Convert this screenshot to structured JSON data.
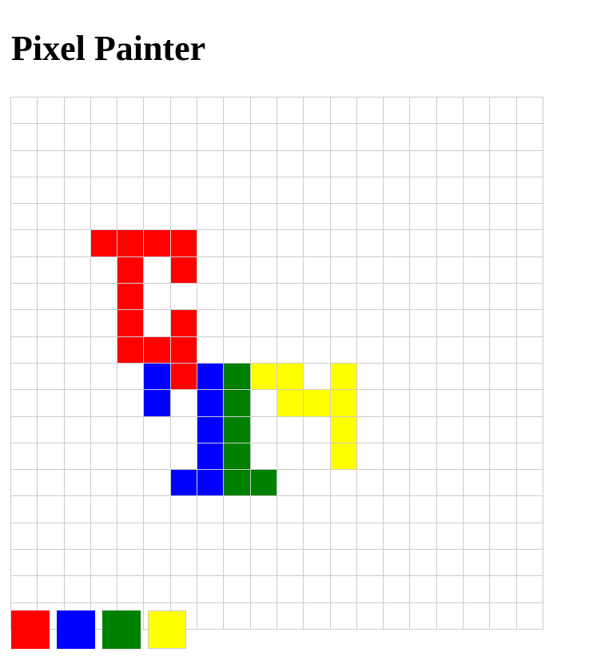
{
  "title": "Pixel Painter",
  "grid": {
    "cols": 20,
    "rows": 20,
    "empty_color": "#ffffff",
    "line_color": "#cccccc",
    "painted_cells": [
      {
        "row": 5,
        "col": 3,
        "color": "red"
      },
      {
        "row": 5,
        "col": 4,
        "color": "red"
      },
      {
        "row": 5,
        "col": 5,
        "color": "red"
      },
      {
        "row": 5,
        "col": 6,
        "color": "red"
      },
      {
        "row": 6,
        "col": 4,
        "color": "red"
      },
      {
        "row": 6,
        "col": 6,
        "color": "red"
      },
      {
        "row": 7,
        "col": 4,
        "color": "red"
      },
      {
        "row": 8,
        "col": 4,
        "color": "red"
      },
      {
        "row": 8,
        "col": 6,
        "color": "red"
      },
      {
        "row": 9,
        "col": 4,
        "color": "red"
      },
      {
        "row": 9,
        "col": 5,
        "color": "red"
      },
      {
        "row": 9,
        "col": 6,
        "color": "red"
      },
      {
        "row": 10,
        "col": 5,
        "color": "blue"
      },
      {
        "row": 10,
        "col": 6,
        "color": "red"
      },
      {
        "row": 10,
        "col": 7,
        "color": "blue"
      },
      {
        "row": 10,
        "col": 8,
        "color": "green"
      },
      {
        "row": 10,
        "col": 9,
        "color": "yellow"
      },
      {
        "row": 10,
        "col": 10,
        "color": "yellow"
      },
      {
        "row": 10,
        "col": 12,
        "color": "yellow"
      },
      {
        "row": 11,
        "col": 5,
        "color": "blue"
      },
      {
        "row": 11,
        "col": 7,
        "color": "blue"
      },
      {
        "row": 11,
        "col": 8,
        "color": "green"
      },
      {
        "row": 11,
        "col": 10,
        "color": "yellow"
      },
      {
        "row": 11,
        "col": 11,
        "color": "yellow"
      },
      {
        "row": 11,
        "col": 12,
        "color": "yellow"
      },
      {
        "row": 12,
        "col": 7,
        "color": "blue"
      },
      {
        "row": 12,
        "col": 8,
        "color": "green"
      },
      {
        "row": 12,
        "col": 12,
        "color": "yellow"
      },
      {
        "row": 13,
        "col": 7,
        "color": "blue"
      },
      {
        "row": 13,
        "col": 8,
        "color": "green"
      },
      {
        "row": 13,
        "col": 12,
        "color": "yellow"
      },
      {
        "row": 14,
        "col": 6,
        "color": "blue"
      },
      {
        "row": 14,
        "col": 7,
        "color": "blue"
      },
      {
        "row": 14,
        "col": 8,
        "color": "green"
      },
      {
        "row": 14,
        "col": 9,
        "color": "green"
      }
    ]
  },
  "palette": {
    "colors": [
      {
        "name": "red",
        "hex": "#ff0000"
      },
      {
        "name": "blue",
        "hex": "#0000ff"
      },
      {
        "name": "green",
        "hex": "#008000"
      },
      {
        "name": "yellow",
        "hex": "#ffff00"
      }
    ],
    "selected": "yellow"
  }
}
